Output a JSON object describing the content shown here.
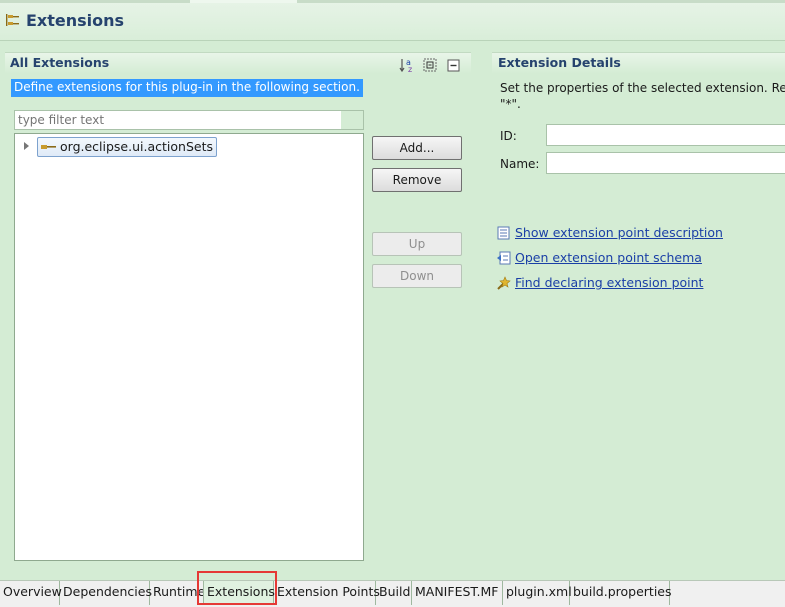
{
  "page": {
    "title": "Extensions"
  },
  "all_extensions": {
    "title": "All Extensions",
    "description": "Define extensions for this plug-in in the following section.",
    "filter_placeholder": "type filter text",
    "tree_items": [
      "org.eclipse.ui.actionSets"
    ],
    "buttons": {
      "add": "Add...",
      "remove": "Remove",
      "up": "Up",
      "down": "Down"
    },
    "toolbar_icons": [
      "sort-az-icon",
      "collapse-all-icon",
      "minimize-icon"
    ]
  },
  "details": {
    "title": "Extension Details",
    "description_line1": "Set the properties of the selected extension. Req",
    "description_line2": "\"*\".",
    "id_label": "ID:",
    "name_label": "Name:",
    "links": [
      {
        "label": "Show extension point description",
        "icon": "description-icon"
      },
      {
        "label": "Open extension point schema",
        "icon": "schema-icon"
      },
      {
        "label": "Find declaring extension point",
        "icon": "find-icon"
      }
    ]
  },
  "bottom_tabs": {
    "active": "Extensions",
    "items": [
      "Overview",
      "Dependencies",
      "Runtime",
      "Extensions",
      "Extension Points",
      "Build",
      "MANIFEST.MF",
      "plugin.xml",
      "build.properties"
    ]
  },
  "colors": {
    "background": "#d4ecd4",
    "title": "#26436e",
    "link": "#1a3fa6",
    "selection": "#3399ff",
    "highlight_outline": "#e53935"
  }
}
